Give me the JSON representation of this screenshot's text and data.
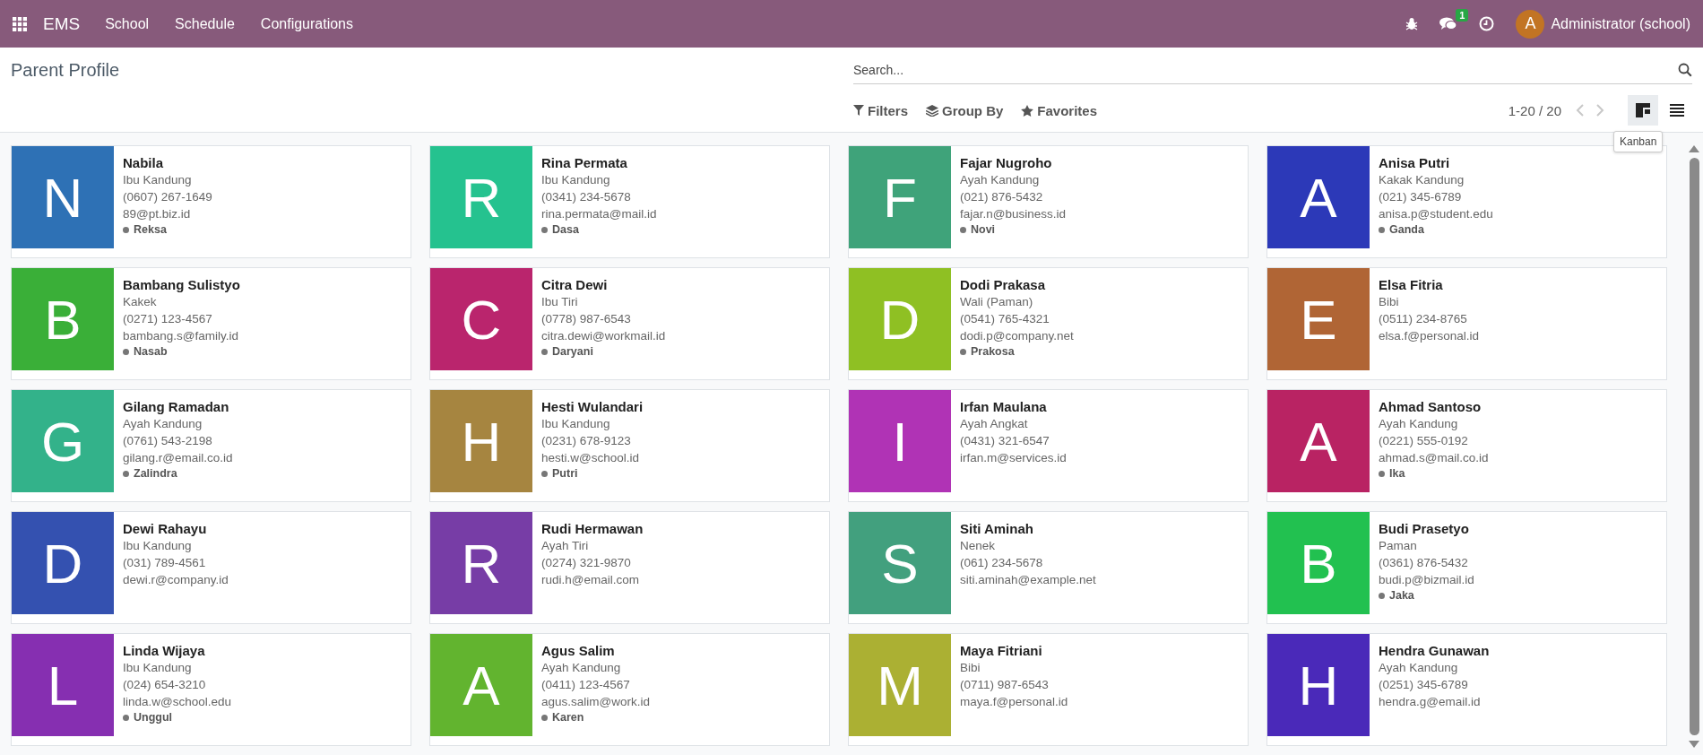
{
  "navbar": {
    "app_name": "EMS",
    "menu": [
      "School",
      "Schedule",
      "Configurations"
    ],
    "message_count": "1",
    "user_initial": "A",
    "user_name": "Administrator (school)"
  },
  "control_panel": {
    "title": "Parent Profile",
    "search": {
      "placeholder": "Search..."
    },
    "filters": [
      "Filters",
      "Group By",
      "Favorites"
    ],
    "pager": "1-20 / 20",
    "views": [
      {
        "kind": "kanban",
        "selected": true
      },
      {
        "kind": "list",
        "selected": false
      }
    ],
    "tooltip": "Kanban"
  },
  "cards": [
    {
      "initial": "N",
      "color": "#2e71b5",
      "name": "Nabila",
      "relation": "Ibu Kandung",
      "phone": "(0607) 267-1649",
      "email": "89@pt.biz.id",
      "tag": "Reksa"
    },
    {
      "initial": "R",
      "color": "#25c28f",
      "name": "Rina Permata",
      "relation": "Ibu Kandung",
      "phone": "(0341) 234-5678",
      "email": "rina.permata@mail.id",
      "tag": "Dasa"
    },
    {
      "initial": "F",
      "color": "#3fa37a",
      "name": "Fajar Nugroho",
      "relation": "Ayah Kandung",
      "phone": "(021) 876-5432",
      "email": "fajar.n@business.id",
      "tag": "Novi"
    },
    {
      "initial": "A",
      "color": "#2c39b8",
      "name": "Anisa Putri",
      "relation": "Kakak Kandung",
      "phone": "(021) 345-6789",
      "email": "anisa.p@student.edu",
      "tag": "Ganda"
    },
    {
      "initial": "B",
      "color": "#3aaf38",
      "name": "Bambang Sulistyo",
      "relation": "Kakek",
      "phone": "(0271) 123-4567",
      "email": "bambang.s@family.id",
      "tag": "Nasab"
    },
    {
      "initial": "C",
      "color": "#ba256d",
      "name": "Citra Dewi",
      "relation": "Ibu Tiri",
      "phone": "(0778) 987-6543",
      "email": "citra.dewi@workmail.id",
      "tag": "Daryani"
    },
    {
      "initial": "D",
      "color": "#8fc023",
      "name": "Dodi Prakasa",
      "relation": "Wali (Paman)",
      "phone": "(0541) 765-4321",
      "email": "dodi.p@company.net",
      "tag": "Prakosa"
    },
    {
      "initial": "E",
      "color": "#b06535",
      "name": "Elsa Fitria",
      "relation": "Bibi",
      "phone": "(0511) 234-8765",
      "email": "elsa.f@personal.id"
    },
    {
      "initial": "G",
      "color": "#33b28a",
      "name": "Gilang Ramadan",
      "relation": "Ayah Kandung",
      "phone": "(0761) 543-2198",
      "email": "gilang.r@email.co.id",
      "tag": "Zalindra"
    },
    {
      "initial": "H",
      "color": "#a68540",
      "name": "Hesti Wulandari",
      "relation": "Ibu Kandung",
      "phone": "(0231) 678-9123",
      "email": "hesti.w@school.id",
      "tag": "Putri"
    },
    {
      "initial": "I",
      "color": "#b033b5",
      "name": "Irfan Maulana",
      "relation": "Ayah Angkat",
      "phone": "(0431) 321-6547",
      "email": "irfan.m@services.id"
    },
    {
      "initial": "A",
      "color": "#b92363",
      "name": "Ahmad Santoso",
      "relation": "Ayah Kandung",
      "phone": "(0221) 555-0192",
      "email": "ahmad.s@mail.co.id",
      "tag": "Ika"
    },
    {
      "initial": "D",
      "color": "#3451b0",
      "name": "Dewi Rahayu",
      "relation": "Ibu Kandung",
      "phone": "(031) 789-4561",
      "email": "dewi.r@company.id"
    },
    {
      "initial": "R",
      "color": "#773da6",
      "name": "Rudi Hermawan",
      "relation": "Ayah Tiri",
      "phone": "(0274) 321-9870",
      "email": "rudi.h@email.com"
    },
    {
      "initial": "S",
      "color": "#42a07e",
      "name": "Siti Aminah",
      "relation": "Nenek",
      "phone": "(061) 234-5678",
      "email": "siti.aminah@example.net"
    },
    {
      "initial": "B",
      "color": "#22c150",
      "name": "Budi Prasetyo",
      "relation": "Paman",
      "phone": "(0361) 876-5432",
      "email": "budi.p@bizmail.id",
      "tag": "Jaka"
    },
    {
      "initial": "L",
      "color": "#862fb1",
      "name": "Linda Wijaya",
      "relation": "Ibu Kandung",
      "phone": "(024) 654-3210",
      "email": "linda.w@school.edu",
      "tag": "Unggul"
    },
    {
      "initial": "A",
      "color": "#62b42f",
      "name": "Agus Salim",
      "relation": "Ayah Kandung",
      "phone": "(0411) 123-4567",
      "email": "agus.salim@work.id",
      "tag": "Karen"
    },
    {
      "initial": "M",
      "color": "#abb033",
      "name": "Maya Fitriani",
      "relation": "Bibi",
      "phone": "(0711) 987-6543",
      "email": "maya.f@personal.id"
    },
    {
      "initial": "H",
      "color": "#4a29b9",
      "name": "Hendra Gunawan",
      "relation": "Ayah Kandung",
      "phone": "(0251) 345-6789",
      "email": "hendra.g@email.id"
    }
  ]
}
